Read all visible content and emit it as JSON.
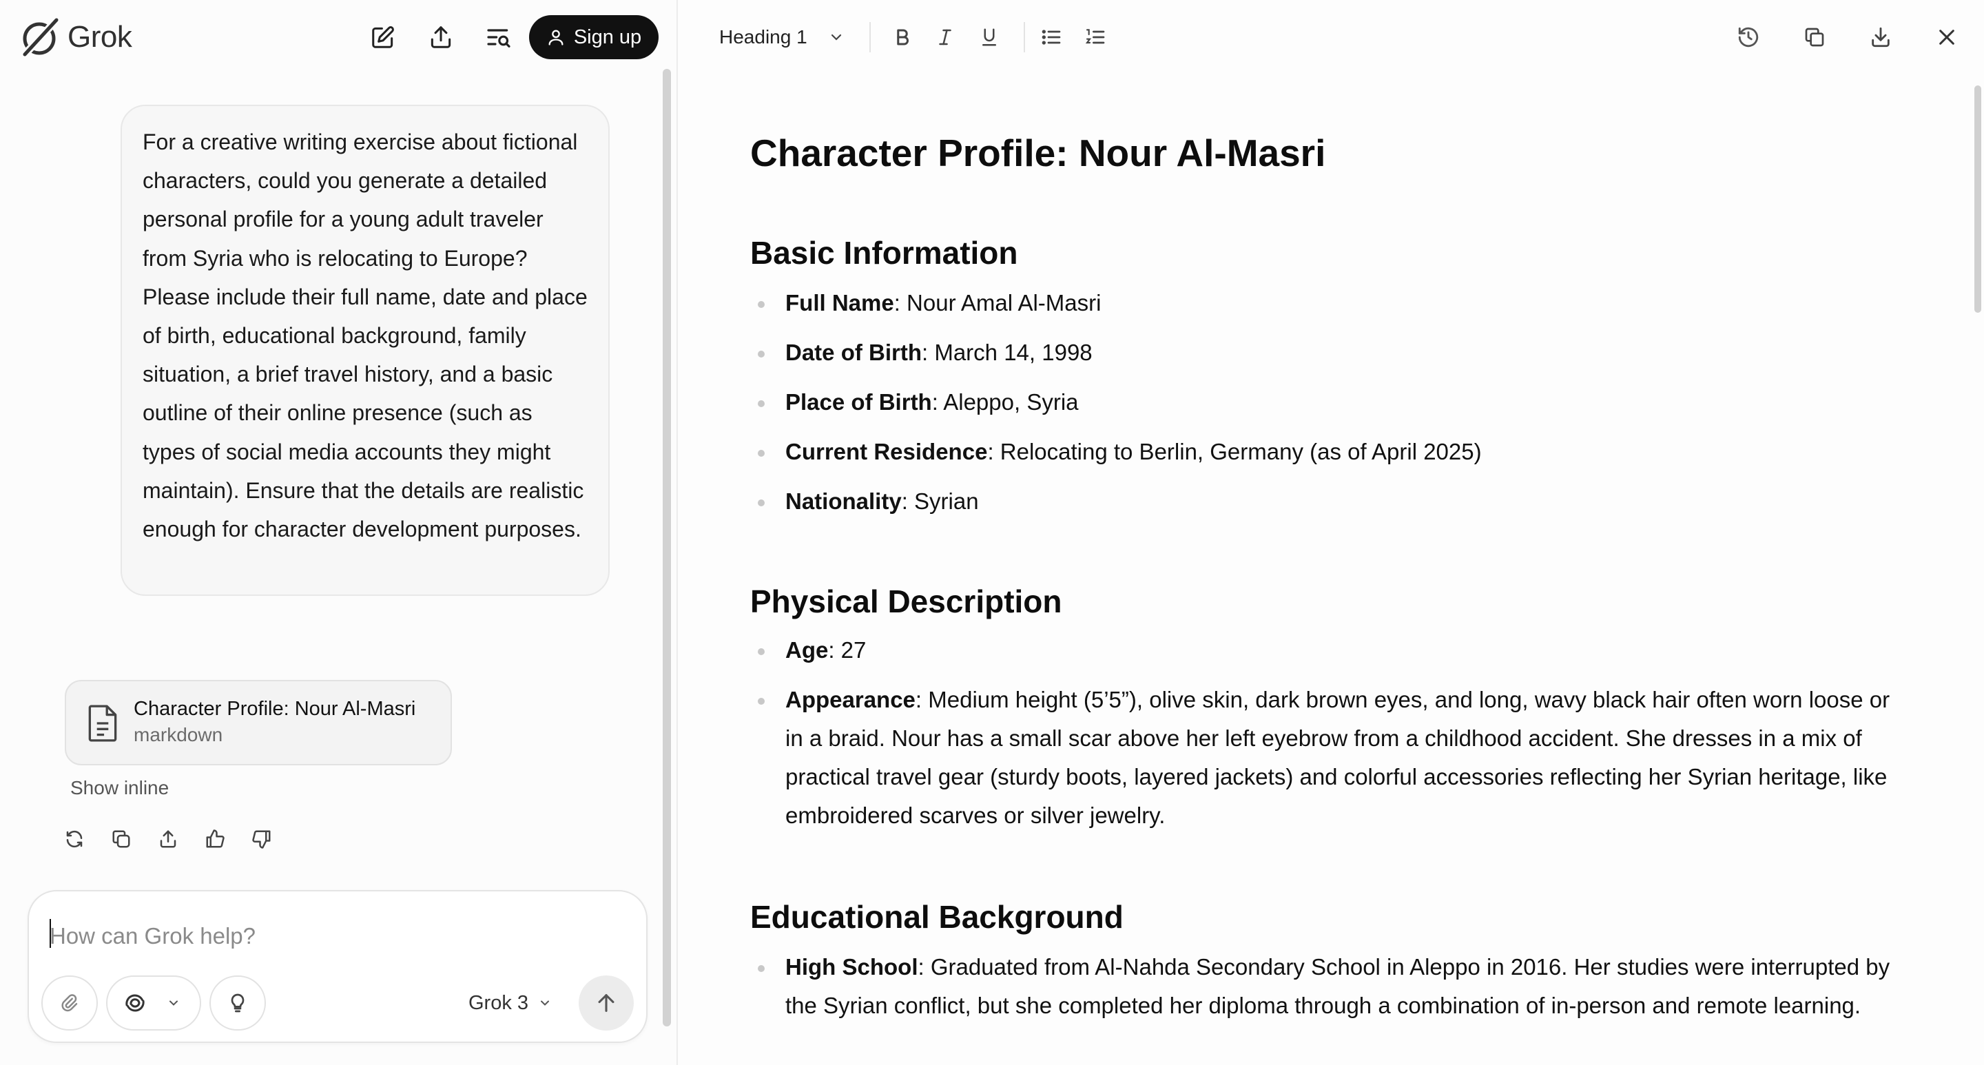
{
  "app": {
    "name": "Grok"
  },
  "header": {
    "signup_label": "Sign up"
  },
  "chat": {
    "user_message": "For a creative writing exercise about fictional characters, could you generate a detailed personal profile for a young adult traveler from Syria who is relocating to Europe? Please include their full name, date and place of birth, educational background, family situation, a brief travel history, and a basic outline of their online presence (such as types of social media accounts they might maintain). Ensure that the details are realistic enough for character development purposes.",
    "artifact": {
      "title": "Character Profile: Nour Al-Masri",
      "type": "markdown"
    },
    "show_inline_label": "Show inline",
    "action_icons": [
      "regenerate-icon",
      "copy-icon",
      "share-icon",
      "thumbs-up-icon",
      "thumbs-down-icon"
    ]
  },
  "composer": {
    "placeholder": "How can Grok help?",
    "model_label": "Grok 3"
  },
  "editor": {
    "block_type": "Heading 1",
    "toolbar_icons": [
      "bold-icon",
      "italic-icon",
      "underline-icon",
      "bullet-list-icon",
      "numbered-list-icon",
      "history-icon",
      "copy-icon",
      "download-icon",
      "close-icon"
    ],
    "title": "Character Profile: Nour Al-Masri",
    "sections": [
      {
        "heading": "Basic Information",
        "items": [
          {
            "label": "Full Name",
            "text": ": Nour Amal Al-Masri"
          },
          {
            "label": "Date of Birth",
            "text": ": March 14, 1998"
          },
          {
            "label": "Place of Birth",
            "text": ": Aleppo, Syria"
          },
          {
            "label": "Current Residence",
            "text": ": Relocating to Berlin, Germany (as of April 2025)"
          },
          {
            "label": "Nationality",
            "text": ": Syrian"
          }
        ]
      },
      {
        "heading": "Physical Description",
        "items": [
          {
            "label": "Age",
            "text": ": 27"
          },
          {
            "label": "Appearance",
            "text": ": Medium height (5’5”), olive skin, dark brown eyes, and long, wavy black hair often worn loose or in a braid. Nour has a small scar above her left eyebrow from a childhood accident. She dresses in a mix of practical travel gear (sturdy boots, layered jackets) and colorful accessories reflecting her Syrian heritage, like embroidered scarves or silver jewelry."
          }
        ]
      },
      {
        "heading": "Educational Background",
        "items": [
          {
            "label": "High School",
            "text": ": Graduated from Al-Nahda Secondary School in Aleppo in 2016. Her studies were interrupted by the Syrian conflict, but she completed her diploma through a combination of in-person and remote learning."
          }
        ]
      }
    ]
  }
}
